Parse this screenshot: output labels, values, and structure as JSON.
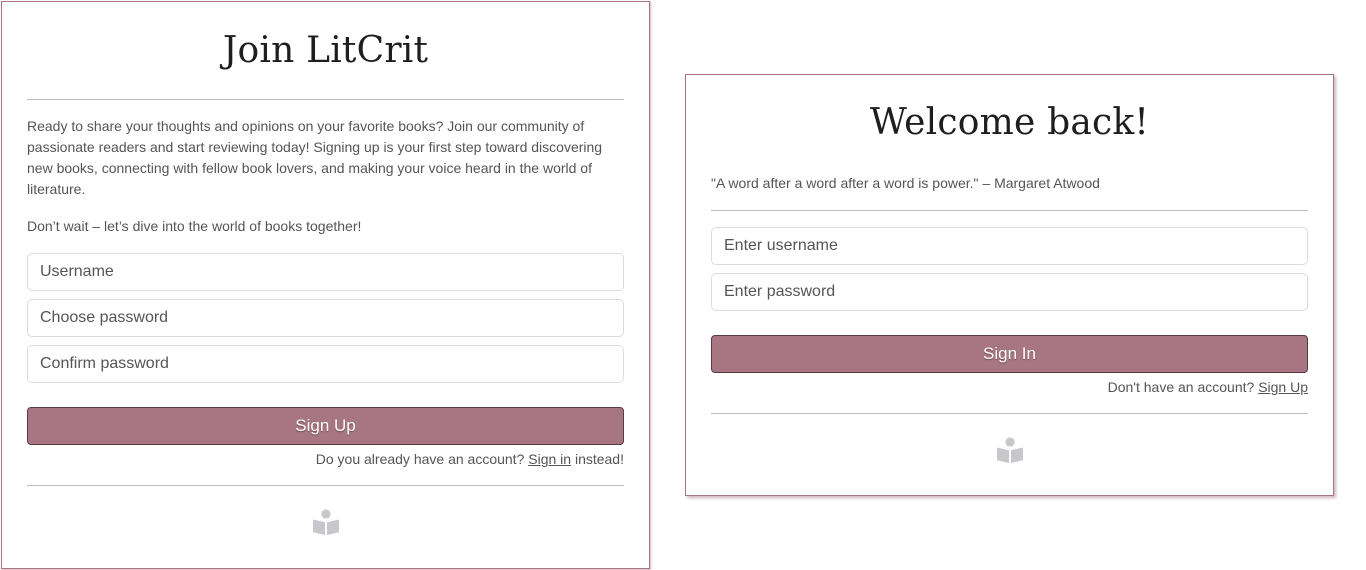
{
  "signup": {
    "title": "Join LitCrit",
    "intro_1": "Ready to share your thoughts and opinions on your favorite books? Join our community of passionate readers and start reviewing today! Signing up is your first step toward discovering new books, connecting with fellow book lovers, and making your voice heard in the world of literature.",
    "intro_2": "Don’t wait – let’s dive into the world of books together!",
    "username_placeholder": "Username",
    "password_placeholder": "Choose password",
    "confirm_placeholder": "Confirm password",
    "button_label": "Sign Up",
    "note_prefix": "Do you already have an account? ",
    "note_link": "Sign in",
    "note_suffix": " instead!",
    "icon": "reader-book-icon"
  },
  "signin": {
    "title": "Welcome back!",
    "quote": "\"A word after a word after a word is power.\" – Margaret Atwood",
    "username_placeholder": "Enter username",
    "password_placeholder": "Enter password",
    "button_label": "Sign In",
    "note_prefix": "Don't have an account? ",
    "note_link": "Sign Up",
    "icon": "reader-book-icon"
  },
  "colors": {
    "accent": "#a87583",
    "button_border": "#5a3a44",
    "icon": "#c8c8cc"
  }
}
